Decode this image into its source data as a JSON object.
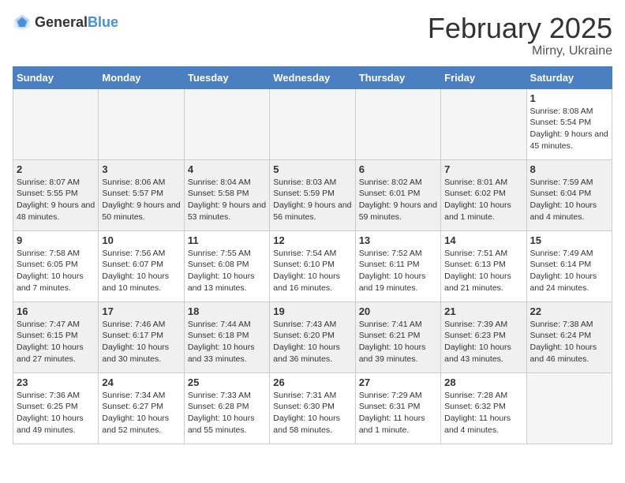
{
  "header": {
    "logo_general": "General",
    "logo_blue": "Blue",
    "month_title": "February 2025",
    "location": "Mirny, Ukraine"
  },
  "weekdays": [
    "Sunday",
    "Monday",
    "Tuesday",
    "Wednesday",
    "Thursday",
    "Friday",
    "Saturday"
  ],
  "weeks": [
    [
      {
        "day": "",
        "info": ""
      },
      {
        "day": "",
        "info": ""
      },
      {
        "day": "",
        "info": ""
      },
      {
        "day": "",
        "info": ""
      },
      {
        "day": "",
        "info": ""
      },
      {
        "day": "",
        "info": ""
      },
      {
        "day": "1",
        "info": "Sunrise: 8:08 AM\nSunset: 5:54 PM\nDaylight: 9 hours and 45 minutes."
      }
    ],
    [
      {
        "day": "2",
        "info": "Sunrise: 8:07 AM\nSunset: 5:55 PM\nDaylight: 9 hours and 48 minutes."
      },
      {
        "day": "3",
        "info": "Sunrise: 8:06 AM\nSunset: 5:57 PM\nDaylight: 9 hours and 50 minutes."
      },
      {
        "day": "4",
        "info": "Sunrise: 8:04 AM\nSunset: 5:58 PM\nDaylight: 9 hours and 53 minutes."
      },
      {
        "day": "5",
        "info": "Sunrise: 8:03 AM\nSunset: 5:59 PM\nDaylight: 9 hours and 56 minutes."
      },
      {
        "day": "6",
        "info": "Sunrise: 8:02 AM\nSunset: 6:01 PM\nDaylight: 9 hours and 59 minutes."
      },
      {
        "day": "7",
        "info": "Sunrise: 8:01 AM\nSunset: 6:02 PM\nDaylight: 10 hours and 1 minute."
      },
      {
        "day": "8",
        "info": "Sunrise: 7:59 AM\nSunset: 6:04 PM\nDaylight: 10 hours and 4 minutes."
      }
    ],
    [
      {
        "day": "9",
        "info": "Sunrise: 7:58 AM\nSunset: 6:05 PM\nDaylight: 10 hours and 7 minutes."
      },
      {
        "day": "10",
        "info": "Sunrise: 7:56 AM\nSunset: 6:07 PM\nDaylight: 10 hours and 10 minutes."
      },
      {
        "day": "11",
        "info": "Sunrise: 7:55 AM\nSunset: 6:08 PM\nDaylight: 10 hours and 13 minutes."
      },
      {
        "day": "12",
        "info": "Sunrise: 7:54 AM\nSunset: 6:10 PM\nDaylight: 10 hours and 16 minutes."
      },
      {
        "day": "13",
        "info": "Sunrise: 7:52 AM\nSunset: 6:11 PM\nDaylight: 10 hours and 19 minutes."
      },
      {
        "day": "14",
        "info": "Sunrise: 7:51 AM\nSunset: 6:13 PM\nDaylight: 10 hours and 21 minutes."
      },
      {
        "day": "15",
        "info": "Sunrise: 7:49 AM\nSunset: 6:14 PM\nDaylight: 10 hours and 24 minutes."
      }
    ],
    [
      {
        "day": "16",
        "info": "Sunrise: 7:47 AM\nSunset: 6:15 PM\nDaylight: 10 hours and 27 minutes."
      },
      {
        "day": "17",
        "info": "Sunrise: 7:46 AM\nSunset: 6:17 PM\nDaylight: 10 hours and 30 minutes."
      },
      {
        "day": "18",
        "info": "Sunrise: 7:44 AM\nSunset: 6:18 PM\nDaylight: 10 hours and 33 minutes."
      },
      {
        "day": "19",
        "info": "Sunrise: 7:43 AM\nSunset: 6:20 PM\nDaylight: 10 hours and 36 minutes."
      },
      {
        "day": "20",
        "info": "Sunrise: 7:41 AM\nSunset: 6:21 PM\nDaylight: 10 hours and 39 minutes."
      },
      {
        "day": "21",
        "info": "Sunrise: 7:39 AM\nSunset: 6:23 PM\nDaylight: 10 hours and 43 minutes."
      },
      {
        "day": "22",
        "info": "Sunrise: 7:38 AM\nSunset: 6:24 PM\nDaylight: 10 hours and 46 minutes."
      }
    ],
    [
      {
        "day": "23",
        "info": "Sunrise: 7:36 AM\nSunset: 6:25 PM\nDaylight: 10 hours and 49 minutes."
      },
      {
        "day": "24",
        "info": "Sunrise: 7:34 AM\nSunset: 6:27 PM\nDaylight: 10 hours and 52 minutes."
      },
      {
        "day": "25",
        "info": "Sunrise: 7:33 AM\nSunset: 6:28 PM\nDaylight: 10 hours and 55 minutes."
      },
      {
        "day": "26",
        "info": "Sunrise: 7:31 AM\nSunset: 6:30 PM\nDaylight: 10 hours and 58 minutes."
      },
      {
        "day": "27",
        "info": "Sunrise: 7:29 AM\nSunset: 6:31 PM\nDaylight: 11 hours and 1 minute."
      },
      {
        "day": "28",
        "info": "Sunrise: 7:28 AM\nSunset: 6:32 PM\nDaylight: 11 hours and 4 minutes."
      },
      {
        "day": "",
        "info": ""
      }
    ]
  ]
}
